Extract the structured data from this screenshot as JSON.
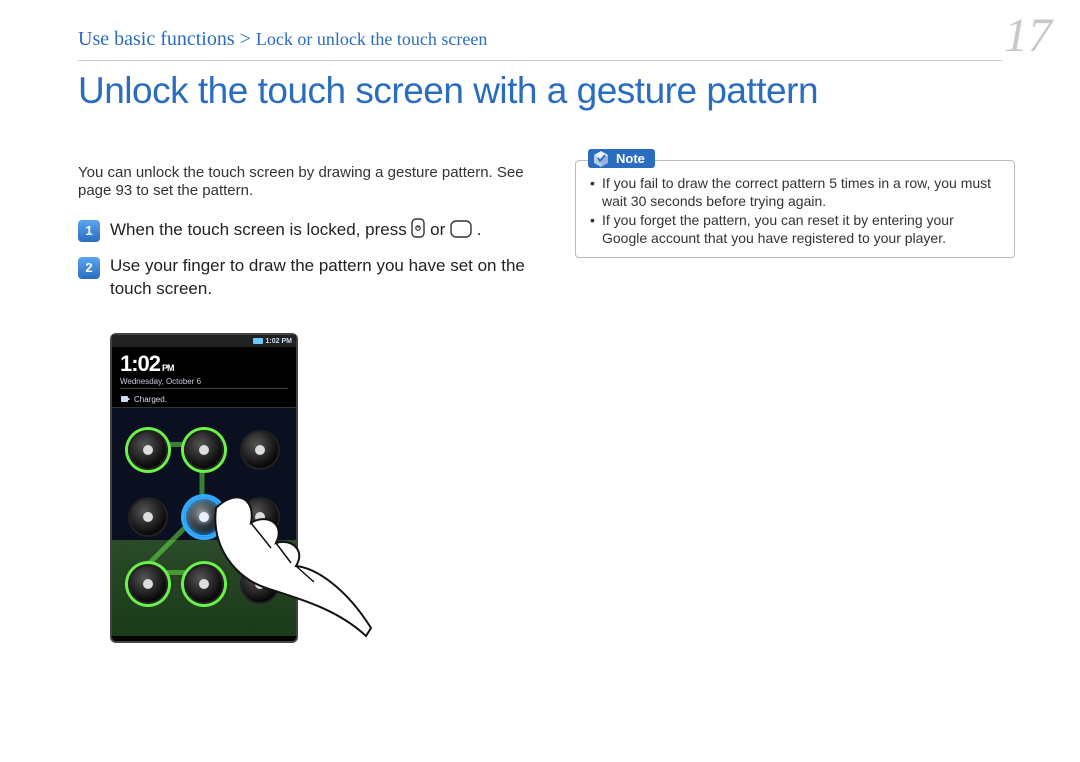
{
  "breadcrumb": {
    "main": "Use basic functions",
    "separator": " > ",
    "sub": "Lock or unlock the touch screen"
  },
  "page_number": "17",
  "heading": "Unlock the touch screen with a gesture pattern",
  "intro": "You can unlock the touch screen by drawing a gesture pattern. See page 93 to set the pattern.",
  "steps": [
    {
      "num": "1",
      "pre": "When the touch screen is locked, press ",
      "mid": " or ",
      "post": "."
    },
    {
      "num": "2",
      "text": "Use your finger to draw the pattern you have set on the touch screen."
    }
  ],
  "note": {
    "label": "Note",
    "items": [
      "If you fail to draw the correct pattern 5 times in a row, you must wait 30 seconds before trying again.",
      "If you forget the pattern, you can reset it by entering your Google account that you have registered to your player."
    ]
  },
  "phone": {
    "status_time": "1:02 PM",
    "clock_time": "1:02",
    "clock_pm": "PM",
    "clock_date": "Wednesday, October 6",
    "charged": "Charged."
  }
}
